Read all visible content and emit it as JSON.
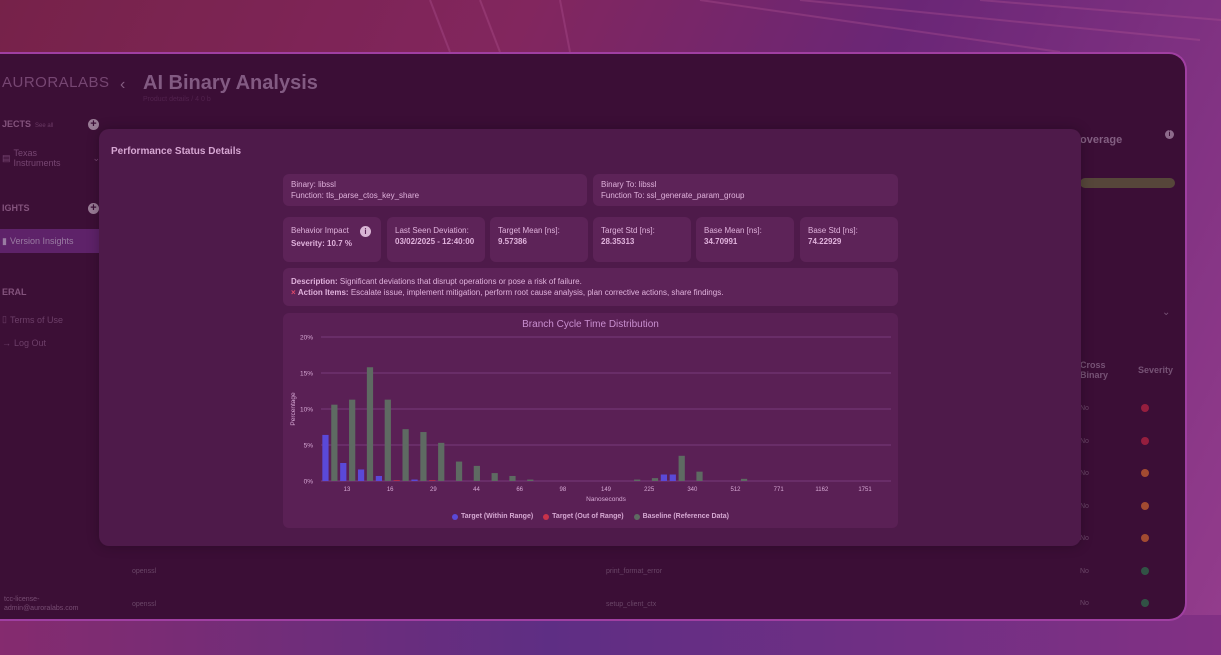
{
  "app": {
    "logo_text": "AURORALABS",
    "title": "AI Binary Analysis",
    "subtitle": "Product details / 4 0 b"
  },
  "sidebar": {
    "projects_label": "JECTS",
    "projects_small": "See all",
    "project_select": "Texas Instruments",
    "insights_label": "IGHTS",
    "active_item": "Version Insights",
    "general_label": "ERAL",
    "terms_label": "Terms of Use",
    "logout_label": "Log Out",
    "user_email_line1": "tcc-license-",
    "user_email_line2": "admin@auroralabs.com"
  },
  "right_panel": {
    "title": "overage",
    "col_cross": "Cross\nBinary",
    "col_cross_1": "Cross",
    "col_cross_2": "Binary",
    "col_severity": "Severity",
    "rows": [
      {
        "cross": "No",
        "color": "#b3243f"
      },
      {
        "cross": "No",
        "color": "#b3243f"
      },
      {
        "cross": "No",
        "color": "#c4612e"
      },
      {
        "cross": "No",
        "color": "#c4612e"
      },
      {
        "cross": "No",
        "color": "#c4612e"
      },
      {
        "cross": "No",
        "color": "#2e6a48"
      },
      {
        "cross": "No",
        "color": "#2e6a48"
      }
    ]
  },
  "bottom_rows": [
    {
      "lib": "openssl",
      "func": "print_format_error",
      "cross": "No"
    },
    {
      "lib": "openssl",
      "func": "setup_client_ctx",
      "cross": "No"
    }
  ],
  "modal": {
    "title": "Performance Status Details",
    "binary_label": "Binary: libssl",
    "function_label": "Function: tls_parse_ctos_key_share",
    "binary_to_label": "Binary To: libssl",
    "function_to_label": "Function To: ssl_generate_param_group",
    "behavior_title": "Behavior Impact",
    "behavior_value": "Severity: 10.7 %",
    "last_seen_title": "Last Seen Deviation:",
    "last_seen_value": "03/02/2025 - 12:40:00",
    "target_mean_title": "Target Mean [ns]:",
    "target_mean_value": "9.57386",
    "target_std_title": "Target Std [ns]:",
    "target_std_value": "28.35313",
    "base_mean_title": "Base Mean [ns]:",
    "base_mean_value": "34.70991",
    "base_std_title": "Base Std [ns]:",
    "base_std_value": "74.22929",
    "description_label": "Description:",
    "description_text": "Significant deviations that disrupt operations or pose a risk of failure.",
    "action_mark": "×",
    "action_label": "Action Items:",
    "action_text": "Escalate issue, implement mitigation, perform root cause analysis, plan corrective actions, share findings."
  },
  "chart_data": {
    "type": "bar",
    "title": "Branch Cycle Time Distribution",
    "xlabel": "Nanoseconds",
    "ylabel": "Percentage",
    "ylim": [
      0,
      20
    ],
    "yticks": [
      "0%",
      "5%",
      "10%",
      "15%",
      "20%"
    ],
    "xticks": [
      "13",
      "16",
      "29",
      "44",
      "66",
      "98",
      "149",
      "225",
      "340",
      "512",
      "771",
      "1162",
      "1751"
    ],
    "n_bins": 64,
    "series": [
      {
        "name": "Target (Within Range)",
        "color": "#5a49d8",
        "bars": [
          [
            0,
            6.4
          ],
          [
            2,
            2.5
          ],
          [
            4,
            1.6
          ],
          [
            6,
            0.7
          ],
          [
            10,
            0.2
          ],
          [
            38,
            0.9
          ],
          [
            39,
            0.9
          ]
        ]
      },
      {
        "name": "Target (Out of Range)",
        "color": "#c8324a",
        "bars": [
          [
            8,
            0.1
          ],
          [
            12,
            0.1
          ]
        ]
      },
      {
        "name": "Baseline (Reference Data)",
        "color": "#5e6a62",
        "bars": [
          [
            1,
            10.6
          ],
          [
            3,
            11.3
          ],
          [
            5,
            15.8
          ],
          [
            7,
            11.3
          ],
          [
            9,
            7.2
          ],
          [
            11,
            6.8
          ],
          [
            13,
            5.3
          ],
          [
            15,
            2.7
          ],
          [
            17,
            2.1
          ],
          [
            19,
            1.1
          ],
          [
            21,
            0.7
          ],
          [
            23,
            0.2
          ],
          [
            35,
            0.2
          ],
          [
            37,
            0.4
          ],
          [
            40,
            3.5
          ],
          [
            42,
            1.3
          ],
          [
            47,
            0.3
          ]
        ]
      }
    ]
  }
}
